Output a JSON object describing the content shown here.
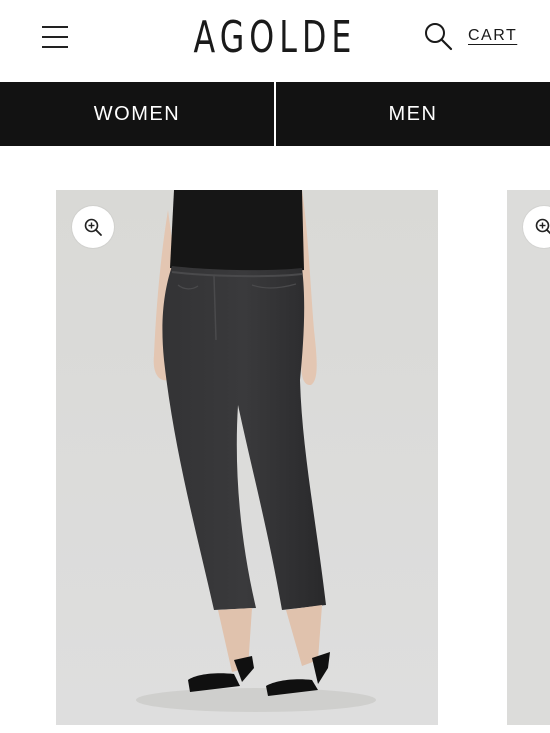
{
  "header": {
    "brand": "AGOLDE",
    "cart_label": "CART",
    "menu_icon": "hamburger-menu-icon",
    "search_icon": "search-icon"
  },
  "nav": {
    "tabs": [
      {
        "label": "WOMEN"
      },
      {
        "label": "MEN"
      }
    ]
  },
  "products": [
    {
      "zoom_icon": "zoom-in-icon",
      "image": "black cropped jeans on model with black top and black heeled sandals"
    },
    {
      "zoom_icon": "zoom-in-icon",
      "image": "partially visible next product image"
    }
  ],
  "colors": {
    "nav_background": "#121212",
    "image_background": "#dcdcda",
    "denim": "#2b2b2d"
  }
}
